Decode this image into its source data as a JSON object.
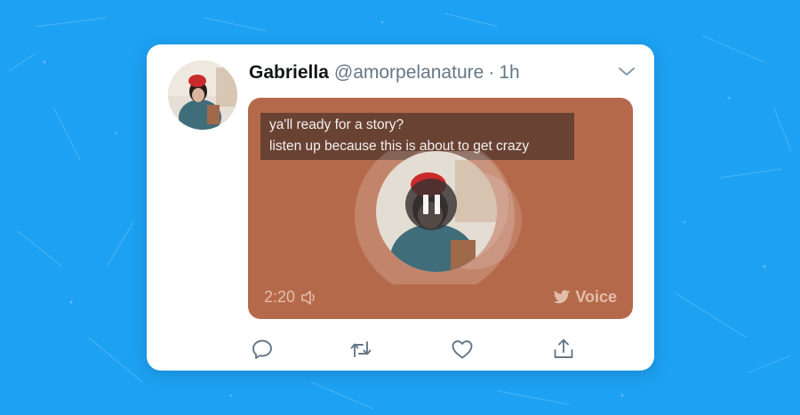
{
  "tweet": {
    "author_name": "Gabriella",
    "author_handle": "@amorpelanature",
    "separator": "·",
    "time": "1h"
  },
  "media": {
    "caption_lines": [
      "ya'll ready for a story?",
      "listen up because this is about to get crazy"
    ],
    "duration": "2:20",
    "brand_label": "Voice",
    "state": "playing"
  },
  "colors": {
    "background": "#1da1f2",
    "media_background": "#b5694b",
    "icon_gray": "#657786"
  },
  "icons": {
    "more": "chevron-down-icon",
    "reply": "reply-icon",
    "retweet": "retweet-icon",
    "like": "heart-icon",
    "share": "share-icon"
  }
}
